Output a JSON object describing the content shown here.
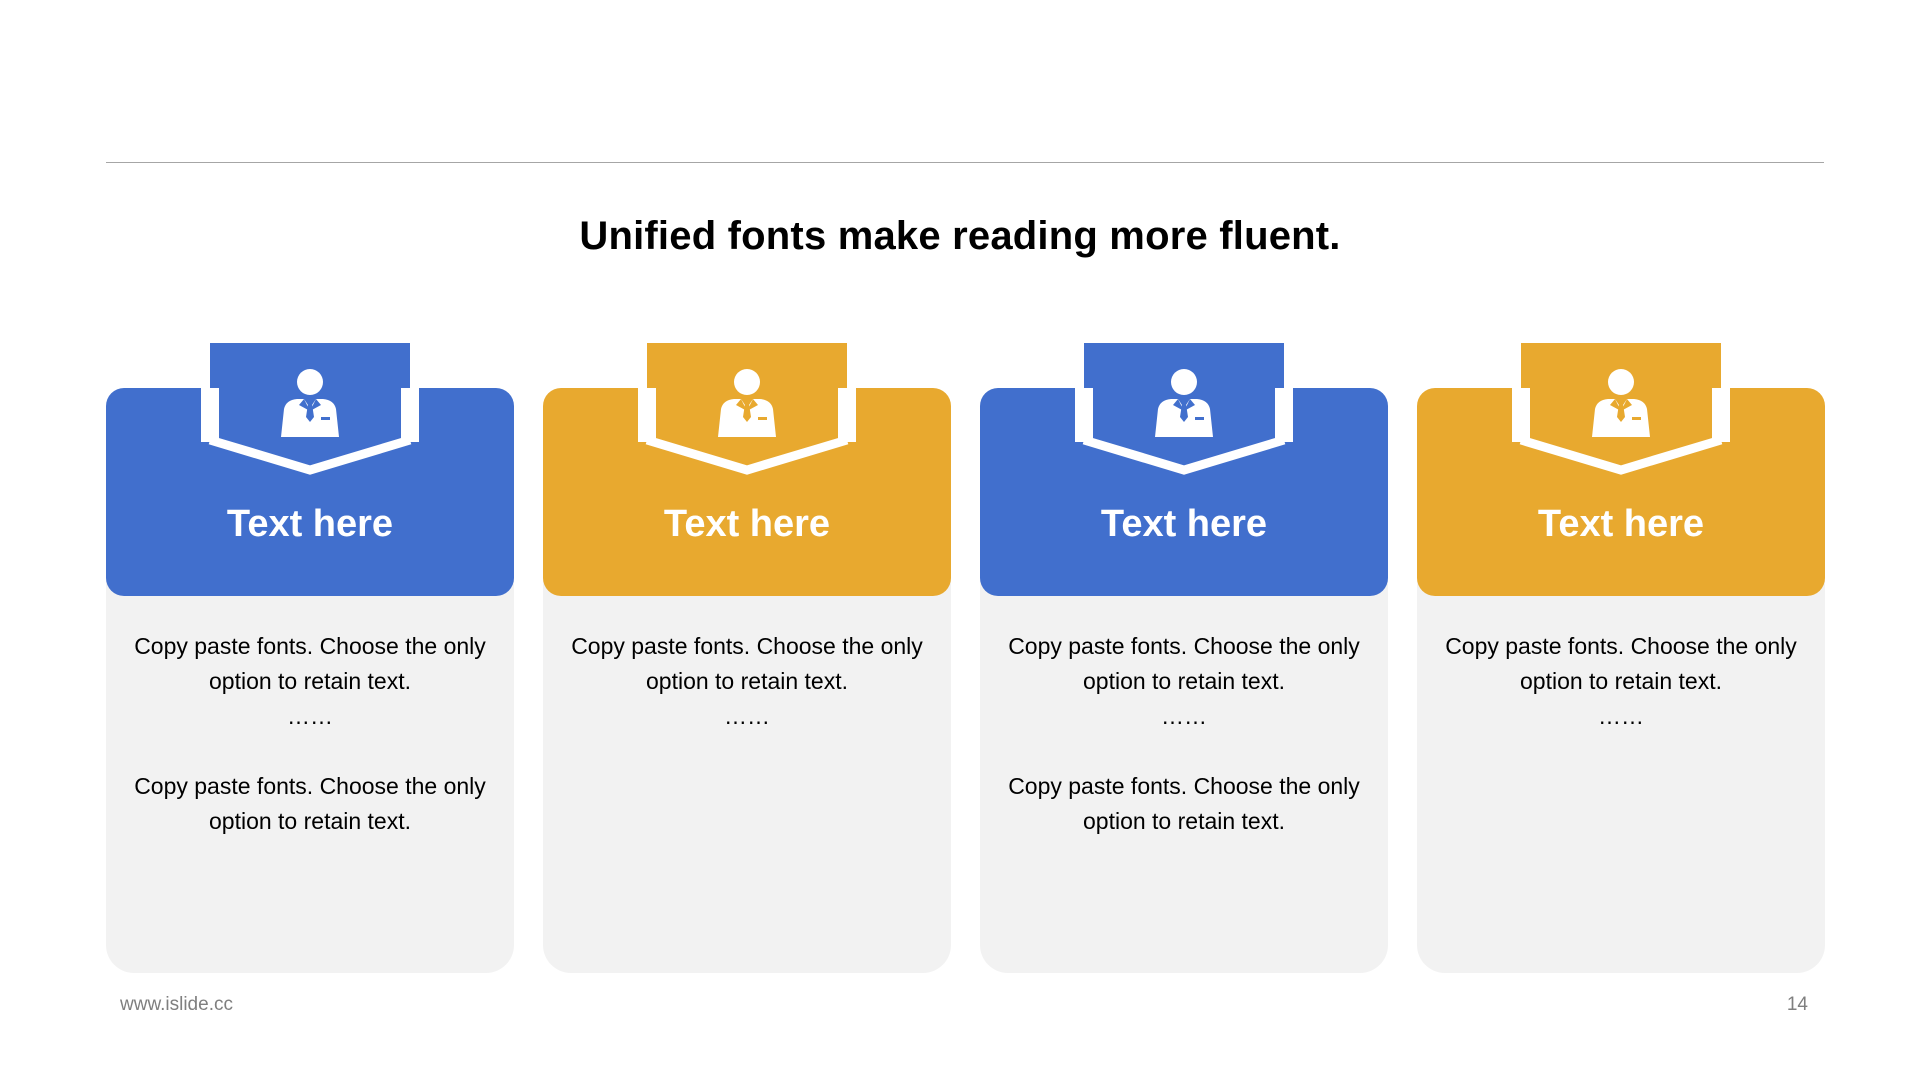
{
  "headline": "Unified fonts make reading more fluent.",
  "colors": {
    "blue": "#416fcd",
    "gold": "#e8a92f",
    "body": "#f2f2f2"
  },
  "icon": "person-in-suit-icon",
  "cards": [
    {
      "title": "Text here",
      "color": "#416fcd",
      "line1": "Copy paste fonts. Choose the only",
      "line2": "option to retain text.",
      "ellipsis": "……",
      "line3": "Copy paste fonts. Choose the only",
      "line4": "option to retain text."
    },
    {
      "title": "Text here",
      "color": "#e8a92f",
      "line1": "Copy paste fonts. Choose the only",
      "line2": "option to retain text.",
      "ellipsis": "……"
    },
    {
      "title": "Text here",
      "color": "#416fcd",
      "line1": "Copy paste fonts. Choose the only",
      "line2": "option to retain text.",
      "ellipsis": "……",
      "line3": "Copy paste fonts. Choose the only",
      "line4": "option to retain text."
    },
    {
      "title": "Text here",
      "color": "#e8a92f",
      "line1": "Copy paste fonts. Choose the only",
      "line2": "option to retain text.",
      "ellipsis": "……"
    }
  ],
  "footer": {
    "url": "www.islide.cc",
    "page": "14"
  }
}
